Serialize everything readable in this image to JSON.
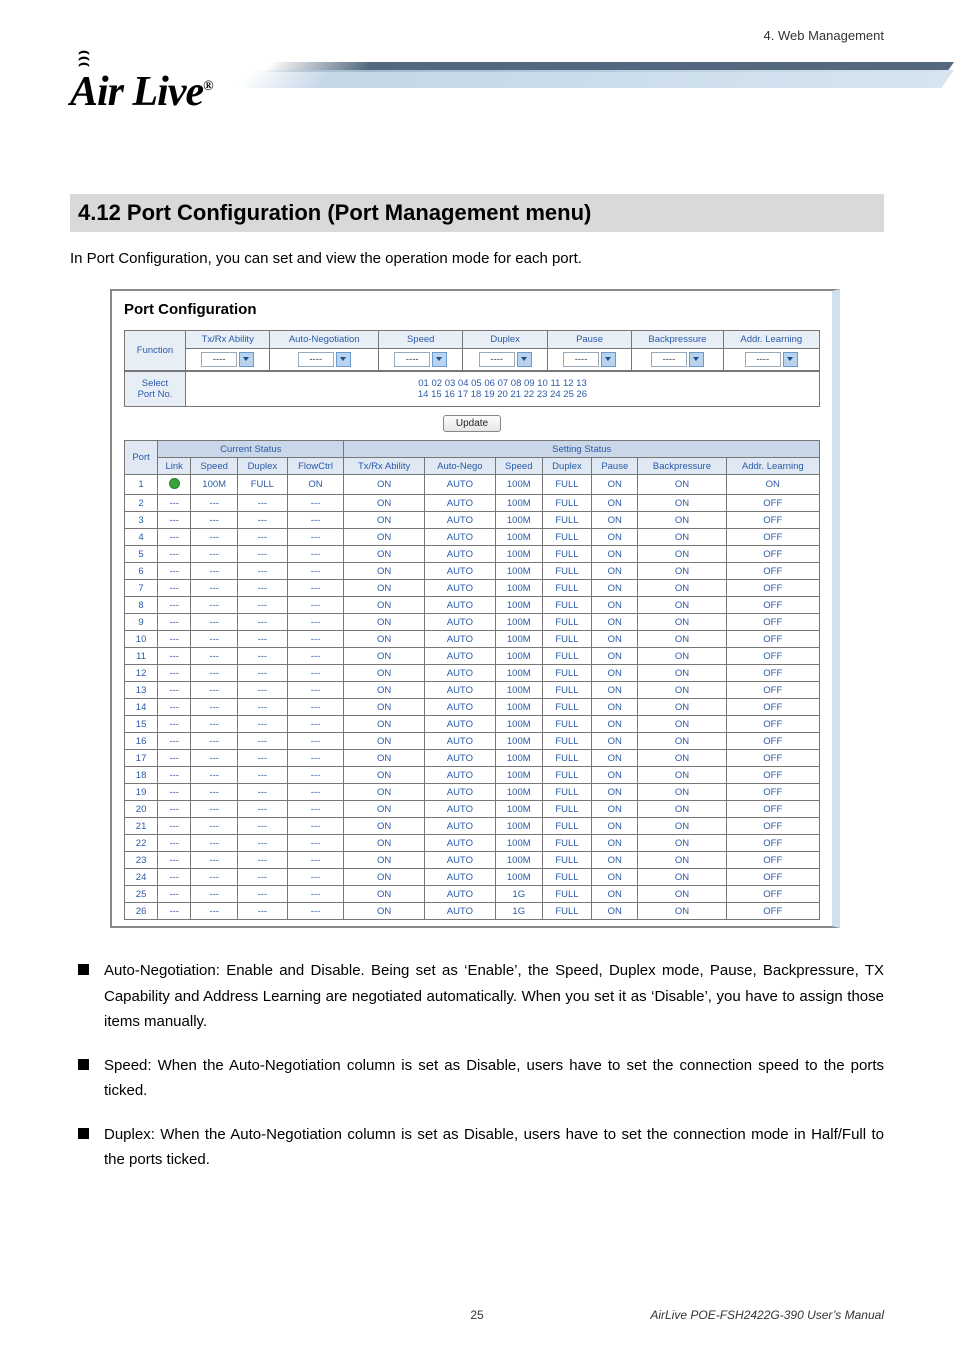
{
  "header": {
    "right_text": "4.  Web Management"
  },
  "logo": {
    "text": "Air Live",
    "reg": "®"
  },
  "section_title": "4.12 Port Configuration (Port Management menu)",
  "intro": "In Port Configuration, you can set and view the operation mode for each port.",
  "shot": {
    "title": "Port Configuration",
    "func_row_label": "Function",
    "func_headers": [
      "Tx/Rx Ability",
      "Auto-Negotiation",
      "Speed",
      "Duplex",
      "Pause",
      "Backpressure",
      "Addr. Learning"
    ],
    "func_values": [
      "----",
      "----",
      "----",
      "----",
      "----",
      "----",
      "----"
    ],
    "select_label": "Select\nPort No.",
    "port_nums_row1": [
      "01",
      "02",
      "03",
      "04",
      "05",
      "06",
      "07",
      "08",
      "09",
      "10",
      "11",
      "12",
      "13"
    ],
    "port_nums_row2": [
      "14",
      "15",
      "16",
      "17",
      "18",
      "19",
      "20",
      "21",
      "22",
      "23",
      "24",
      "25",
      "26"
    ],
    "update_label": "Update",
    "group_headers": [
      "Current Status",
      "Setting Status"
    ],
    "status_headers": [
      "Port",
      "Link",
      "Speed",
      "Duplex",
      "FlowCtrl",
      "Tx/Rx Ability",
      "Auto-Nego",
      "Speed",
      "Duplex",
      "Pause",
      "Backpressure",
      "Addr. Learning"
    ],
    "rows": [
      {
        "port": "1",
        "link": "dot",
        "speed": "100M",
        "duplex": "FULL",
        "flow": "ON",
        "txrx": "ON",
        "nego": "AUTO",
        "sspeed": "100M",
        "sduplex": "FULL",
        "pause": "ON",
        "bp": "ON",
        "addr": "ON"
      },
      {
        "port": "2",
        "link": "---",
        "speed": "---",
        "duplex": "---",
        "flow": "---",
        "txrx": "ON",
        "nego": "AUTO",
        "sspeed": "100M",
        "sduplex": "FULL",
        "pause": "ON",
        "bp": "ON",
        "addr": "OFF"
      },
      {
        "port": "3",
        "link": "---",
        "speed": "---",
        "duplex": "---",
        "flow": "---",
        "txrx": "ON",
        "nego": "AUTO",
        "sspeed": "100M",
        "sduplex": "FULL",
        "pause": "ON",
        "bp": "ON",
        "addr": "OFF"
      },
      {
        "port": "4",
        "link": "---",
        "speed": "---",
        "duplex": "---",
        "flow": "---",
        "txrx": "ON",
        "nego": "AUTO",
        "sspeed": "100M",
        "sduplex": "FULL",
        "pause": "ON",
        "bp": "ON",
        "addr": "OFF"
      },
      {
        "port": "5",
        "link": "---",
        "speed": "---",
        "duplex": "---",
        "flow": "---",
        "txrx": "ON",
        "nego": "AUTO",
        "sspeed": "100M",
        "sduplex": "FULL",
        "pause": "ON",
        "bp": "ON",
        "addr": "OFF"
      },
      {
        "port": "6",
        "link": "---",
        "speed": "---",
        "duplex": "---",
        "flow": "---",
        "txrx": "ON",
        "nego": "AUTO",
        "sspeed": "100M",
        "sduplex": "FULL",
        "pause": "ON",
        "bp": "ON",
        "addr": "OFF"
      },
      {
        "port": "7",
        "link": "---",
        "speed": "---",
        "duplex": "---",
        "flow": "---",
        "txrx": "ON",
        "nego": "AUTO",
        "sspeed": "100M",
        "sduplex": "FULL",
        "pause": "ON",
        "bp": "ON",
        "addr": "OFF"
      },
      {
        "port": "8",
        "link": "---",
        "speed": "---",
        "duplex": "---",
        "flow": "---",
        "txrx": "ON",
        "nego": "AUTO",
        "sspeed": "100M",
        "sduplex": "FULL",
        "pause": "ON",
        "bp": "ON",
        "addr": "OFF"
      },
      {
        "port": "9",
        "link": "---",
        "speed": "---",
        "duplex": "---",
        "flow": "---",
        "txrx": "ON",
        "nego": "AUTO",
        "sspeed": "100M",
        "sduplex": "FULL",
        "pause": "ON",
        "bp": "ON",
        "addr": "OFF"
      },
      {
        "port": "10",
        "link": "---",
        "speed": "---",
        "duplex": "---",
        "flow": "---",
        "txrx": "ON",
        "nego": "AUTO",
        "sspeed": "100M",
        "sduplex": "FULL",
        "pause": "ON",
        "bp": "ON",
        "addr": "OFF"
      },
      {
        "port": "11",
        "link": "---",
        "speed": "---",
        "duplex": "---",
        "flow": "---",
        "txrx": "ON",
        "nego": "AUTO",
        "sspeed": "100M",
        "sduplex": "FULL",
        "pause": "ON",
        "bp": "ON",
        "addr": "OFF"
      },
      {
        "port": "12",
        "link": "---",
        "speed": "---",
        "duplex": "---",
        "flow": "---",
        "txrx": "ON",
        "nego": "AUTO",
        "sspeed": "100M",
        "sduplex": "FULL",
        "pause": "ON",
        "bp": "ON",
        "addr": "OFF"
      },
      {
        "port": "13",
        "link": "---",
        "speed": "---",
        "duplex": "---",
        "flow": "---",
        "txrx": "ON",
        "nego": "AUTO",
        "sspeed": "100M",
        "sduplex": "FULL",
        "pause": "ON",
        "bp": "ON",
        "addr": "OFF"
      },
      {
        "port": "14",
        "link": "---",
        "speed": "---",
        "duplex": "---",
        "flow": "---",
        "txrx": "ON",
        "nego": "AUTO",
        "sspeed": "100M",
        "sduplex": "FULL",
        "pause": "ON",
        "bp": "ON",
        "addr": "OFF"
      },
      {
        "port": "15",
        "link": "---",
        "speed": "---",
        "duplex": "---",
        "flow": "---",
        "txrx": "ON",
        "nego": "AUTO",
        "sspeed": "100M",
        "sduplex": "FULL",
        "pause": "ON",
        "bp": "ON",
        "addr": "OFF"
      },
      {
        "port": "16",
        "link": "---",
        "speed": "---",
        "duplex": "---",
        "flow": "---",
        "txrx": "ON",
        "nego": "AUTO",
        "sspeed": "100M",
        "sduplex": "FULL",
        "pause": "ON",
        "bp": "ON",
        "addr": "OFF"
      },
      {
        "port": "17",
        "link": "---",
        "speed": "---",
        "duplex": "---",
        "flow": "---",
        "txrx": "ON",
        "nego": "AUTO",
        "sspeed": "100M",
        "sduplex": "FULL",
        "pause": "ON",
        "bp": "ON",
        "addr": "OFF"
      },
      {
        "port": "18",
        "link": "---",
        "speed": "---",
        "duplex": "---",
        "flow": "---",
        "txrx": "ON",
        "nego": "AUTO",
        "sspeed": "100M",
        "sduplex": "FULL",
        "pause": "ON",
        "bp": "ON",
        "addr": "OFF"
      },
      {
        "port": "19",
        "link": "---",
        "speed": "---",
        "duplex": "---",
        "flow": "---",
        "txrx": "ON",
        "nego": "AUTO",
        "sspeed": "100M",
        "sduplex": "FULL",
        "pause": "ON",
        "bp": "ON",
        "addr": "OFF"
      },
      {
        "port": "20",
        "link": "---",
        "speed": "---",
        "duplex": "---",
        "flow": "---",
        "txrx": "ON",
        "nego": "AUTO",
        "sspeed": "100M",
        "sduplex": "FULL",
        "pause": "ON",
        "bp": "ON",
        "addr": "OFF"
      },
      {
        "port": "21",
        "link": "---",
        "speed": "---",
        "duplex": "---",
        "flow": "---",
        "txrx": "ON",
        "nego": "AUTO",
        "sspeed": "100M",
        "sduplex": "FULL",
        "pause": "ON",
        "bp": "ON",
        "addr": "OFF"
      },
      {
        "port": "22",
        "link": "---",
        "speed": "---",
        "duplex": "---",
        "flow": "---",
        "txrx": "ON",
        "nego": "AUTO",
        "sspeed": "100M",
        "sduplex": "FULL",
        "pause": "ON",
        "bp": "ON",
        "addr": "OFF"
      },
      {
        "port": "23",
        "link": "---",
        "speed": "---",
        "duplex": "---",
        "flow": "---",
        "txrx": "ON",
        "nego": "AUTO",
        "sspeed": "100M",
        "sduplex": "FULL",
        "pause": "ON",
        "bp": "ON",
        "addr": "OFF"
      },
      {
        "port": "24",
        "link": "---",
        "speed": "---",
        "duplex": "---",
        "flow": "---",
        "txrx": "ON",
        "nego": "AUTO",
        "sspeed": "100M",
        "sduplex": "FULL",
        "pause": "ON",
        "bp": "ON",
        "addr": "OFF"
      },
      {
        "port": "25",
        "link": "---",
        "speed": "---",
        "duplex": "---",
        "flow": "---",
        "txrx": "ON",
        "nego": "AUTO",
        "sspeed": "1G",
        "sduplex": "FULL",
        "pause": "ON",
        "bp": "ON",
        "addr": "OFF"
      },
      {
        "port": "26",
        "link": "---",
        "speed": "---",
        "duplex": "---",
        "flow": "---",
        "txrx": "ON",
        "nego": "AUTO",
        "sspeed": "1G",
        "sduplex": "FULL",
        "pause": "ON",
        "bp": "ON",
        "addr": "OFF"
      }
    ]
  },
  "bullets": [
    "Auto-Negotiation: Enable and Disable. Being set as ‘Enable’, the Speed, Duplex mode, Pause, Backpressure, TX Capability and Address Learning are negotiated automatically. When you set it as ‘Disable’, you have to assign those items manually.",
    "Speed: When the Auto-Negotiation column is set as Disable, users have to set the connection speed to the ports ticked.",
    "Duplex: When the Auto-Negotiation column is set as Disable, users have to set the connection mode in Half/Full to the ports ticked."
  ],
  "footer": {
    "page": "25",
    "manual": "AirLive POE-FSH2422G-390 User’s Manual"
  }
}
